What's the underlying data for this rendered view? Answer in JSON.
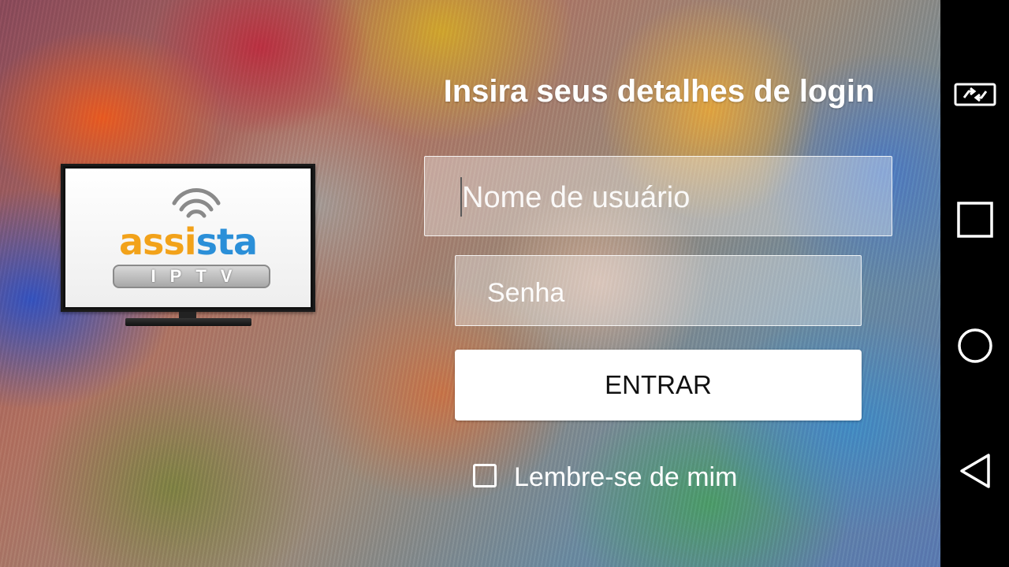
{
  "logo": {
    "brand_part1": "assi",
    "brand_part2": "sta",
    "subtitle": "IPTV",
    "colors": {
      "orange": "#f2a21a",
      "blue": "#2b8fd8"
    }
  },
  "login": {
    "title": "Insira seus detalhes de login",
    "username_placeholder": "Nome de usuário",
    "password_placeholder": "Senha",
    "submit_label": "ENTRAR",
    "remember_label": "Lembre-se de mim",
    "remember_checked": false
  },
  "navbar": {
    "buttons": [
      {
        "icon": "rotate-screen-icon"
      },
      {
        "icon": "recents-square-icon"
      },
      {
        "icon": "home-circle-icon"
      },
      {
        "icon": "back-triangle-icon"
      }
    ]
  }
}
